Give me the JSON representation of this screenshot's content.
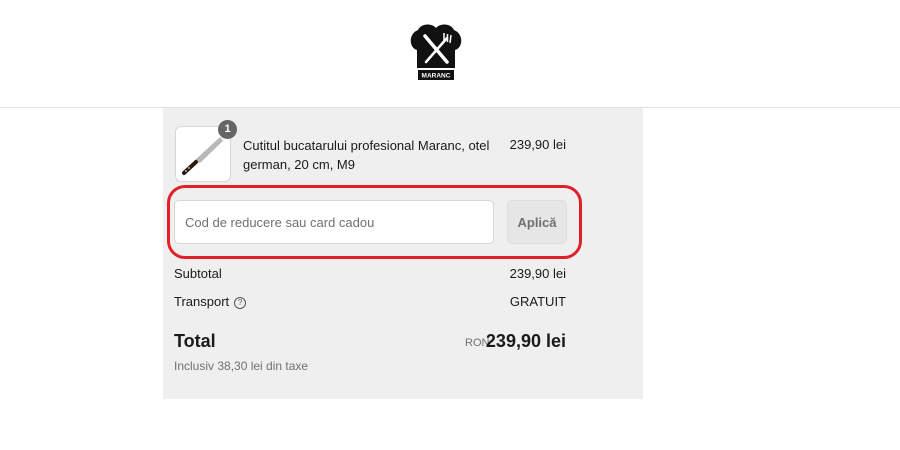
{
  "header": {
    "logo_text": "MARANC",
    "logo_icon": "chef-hat-cutlery-icon"
  },
  "cart": {
    "items": [
      {
        "quantity": "1",
        "name": "Cutitul bucatarului profesional Maranc, otel german, 20 cm, M9",
        "price": "239,90 lei",
        "image_icon": "chef-knife-icon"
      }
    ]
  },
  "discount": {
    "placeholder": "Cod de reducere sau card cadou",
    "value": "",
    "apply_label": "Aplică",
    "highlight_color": "#e0202a"
  },
  "summary": {
    "subtotal_label": "Subtotal",
    "subtotal_value": "239,90 lei",
    "shipping_label": "Transport",
    "shipping_help_icon": "question-circle-icon",
    "shipping_value": "GRATUIT",
    "total_label": "Total",
    "currency": "RON",
    "total_value": "239,90 lei",
    "tax_note": "Inclusiv 38,30 lei din taxe"
  }
}
